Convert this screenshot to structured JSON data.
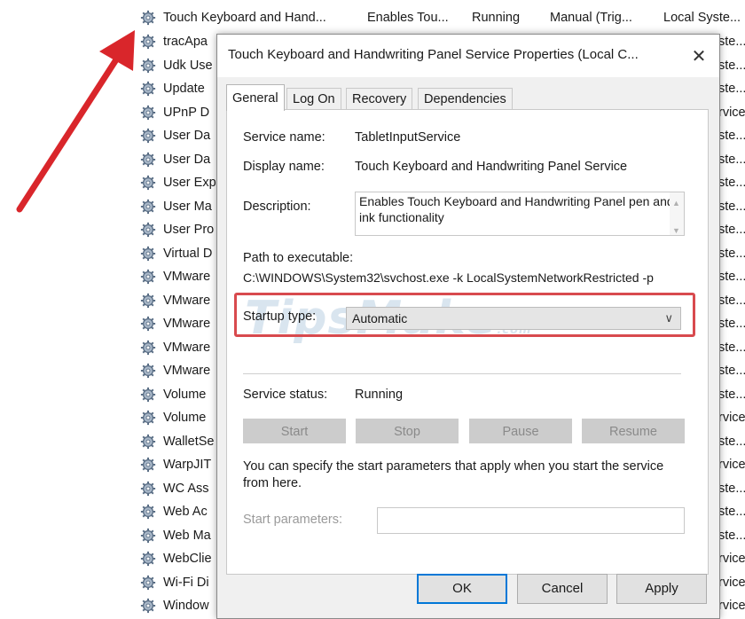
{
  "services_list": {
    "top_row": {
      "name": "Touch Keyboard and Hand...",
      "description": "Enables Tou...",
      "status": "Running",
      "startup_type": "Manual (Trig...",
      "log_on_as": "Local Syste..."
    },
    "rows": [
      {
        "name": "tracApa",
        "startup": "ste..."
      },
      {
        "name": "Udk Use",
        "startup": "ste..."
      },
      {
        "name": "Update",
        "startup": "ste..."
      },
      {
        "name": "UPnP D",
        "startup": "rvice"
      },
      {
        "name": "User Da",
        "startup": "ste..."
      },
      {
        "name": "User Da",
        "startup": "ste..."
      },
      {
        "name": "User Exp",
        "startup": "ste..."
      },
      {
        "name": "User Ma",
        "startup": "ste..."
      },
      {
        "name": "User Pro",
        "startup": "ste..."
      },
      {
        "name": "Virtual D",
        "startup": "ste..."
      },
      {
        "name": "VMware",
        "startup": "ste..."
      },
      {
        "name": "VMware",
        "startup": "ste..."
      },
      {
        "name": "VMware",
        "startup": "ste..."
      },
      {
        "name": "VMware",
        "startup": "ste..."
      },
      {
        "name": "VMware",
        "startup": "ste..."
      },
      {
        "name": "Volume",
        "startup": "ste..."
      },
      {
        "name": "Volume",
        "startup": "rvice"
      },
      {
        "name": "WalletSe",
        "startup": "ste..."
      },
      {
        "name": "WarpJIT",
        "startup": "rvice"
      },
      {
        "name": "WC Ass",
        "startup": "ste..."
      },
      {
        "name": "Web Ac",
        "startup": "ste..."
      },
      {
        "name": "Web Ma",
        "startup": "ste..."
      },
      {
        "name": "WebClie",
        "startup": "rvice"
      },
      {
        "name": "Wi-Fi Di",
        "startup": "rvice"
      },
      {
        "name": "Window",
        "startup": "rvice"
      }
    ]
  },
  "dialog": {
    "title": "Touch Keyboard and Handwriting Panel Service Properties (Local C...",
    "close_glyph": "✕",
    "tabs": [
      {
        "label": "General",
        "active": true
      },
      {
        "label": "Log On",
        "active": false
      },
      {
        "label": "Recovery",
        "active": false
      },
      {
        "label": "Dependencies",
        "active": false
      }
    ],
    "general": {
      "service_name_label": "Service name:",
      "service_name_value": "TabletInputService",
      "display_name_label": "Display name:",
      "display_name_value": "Touch Keyboard and Handwriting Panel Service",
      "description_label": "Description:",
      "description_value": "Enables Touch Keyboard and Handwriting Panel pen and ink functionality",
      "path_label": "Path to executable:",
      "path_value": "C:\\WINDOWS\\System32\\svchost.exe -k LocalSystemNetworkRestricted -p",
      "startup_type_label": "Startup type:",
      "startup_type_value": "Automatic",
      "service_status_label": "Service status:",
      "service_status_value": "Running",
      "buttons": {
        "start": "Start",
        "stop": "Stop",
        "pause": "Pause",
        "resume": "Resume"
      },
      "start_params_hint": "You can specify the start parameters that apply when you start the service from here.",
      "start_params_label": "Start parameters:",
      "start_params_value": ""
    },
    "footer": {
      "ok": "OK",
      "cancel": "Cancel",
      "apply": "Apply"
    }
  },
  "watermark": {
    "brand": "TipsMake",
    "suffix": ".com"
  },
  "colors": {
    "highlight_border": "#d84a4e",
    "arrow": "#d9262b",
    "watermark": "#7aa3c8",
    "dialog_bg": "#f0f0f0",
    "disabled_button": "#cccccc"
  }
}
